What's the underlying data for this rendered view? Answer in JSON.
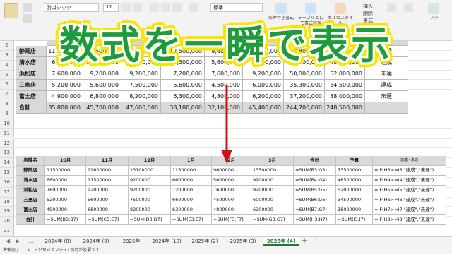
{
  "ribbon": {
    "font_name": "游ゴシック",
    "font_size": "11",
    "number_format": "標準",
    "conditional_format_label": "条件付き書式",
    "table_format_label": "テーブルとして書式設定",
    "cell_style_label": "セルのスタイル",
    "insert_label": "挿入",
    "delete_label": "削除",
    "format_label": "書式",
    "group_alignment": "配置",
    "addin_label": "アド"
  },
  "banner": {
    "text": "数式を一瞬で表示"
  },
  "row_numbers": [
    "2",
    "3",
    "4",
    "5",
    "6",
    "7",
    "8",
    "9",
    "10",
    "11",
    "12",
    "13",
    "14",
    "15",
    "16",
    "17",
    "18",
    "19",
    "20",
    "21"
  ],
  "top_table": {
    "headers": [
      "",
      "",
      "",
      "1月",
      "2月",
      "",
      "合計",
      "予算",
      ""
    ],
    "rows": [
      {
        "name": "静岡店",
        "values": [
          "11,500,000",
          "12,600,000",
          "13,100,000",
          "12,500,000",
          "9,600,000",
          "13,500,000",
          "72,800,000",
          "73,500,000",
          "未達"
        ]
      },
      {
        "name": "清水店",
        "values": [
          "6,600,000",
          "11,500,000",
          "9,200,000",
          "6,600,000",
          "5,600,000",
          "9,200,000",
          "48,600,000",
          "48,500,000",
          "達成"
        ]
      },
      {
        "name": "浜松店",
        "values": [
          "7,600,000",
          "9,200,000",
          "9,200,000",
          "7,200,000",
          "7,600,000",
          "9,200,000",
          "50,000,000",
          "52,000,000",
          "未達"
        ]
      },
      {
        "name": "三島店",
        "values": [
          "5,200,000",
          "5,600,000",
          "7,500,000",
          "6,600,000",
          "4,500,000",
          "6,000,000",
          "35,300,000",
          "34,500,000",
          "達成"
        ]
      },
      {
        "name": "富士店",
        "values": [
          "4,900,000",
          "6,800,000",
          "8,200,000",
          "6,300,000",
          "4,800,000",
          "6,200,000",
          "37,200,000",
          "38,000,000",
          "未達"
        ]
      },
      {
        "name": "合計",
        "values": [
          "35,800,000",
          "45,700,000",
          "47,600,000",
          "38,100,000",
          "32,100,000",
          "45,400,000",
          "244,700,000",
          "248,500,000",
          ""
        ]
      }
    ]
  },
  "bottom_table": {
    "headers": [
      "店舗名",
      "10月",
      "11月",
      "12月",
      "1月",
      "2月",
      "3月",
      "合計",
      "予算",
      "達成・未達"
    ],
    "rows": [
      {
        "name": "静岡店",
        "cells": [
          "11500000",
          "12600000",
          "13100000",
          "12500000",
          "9600000",
          "13500000",
          "=SUM(B3:G3)",
          "73500000",
          "=IF(H3>=I3,\"達成\",\"未達\")"
        ]
      },
      {
        "name": "清水店",
        "cells": [
          "6600000",
          "11500000",
          "9200000",
          "6600000",
          "5600000",
          "9200000",
          "=SUM(B4:G4)",
          "48500000",
          "=IF(H4>=I4,\"達成\",\"未達\")"
        ]
      },
      {
        "name": "浜松店",
        "cells": [
          "7600000",
          "9200000",
          "9200000",
          "7200000",
          "7600000",
          "9200000",
          "=SUM(B5:G5)",
          "52000000",
          "=IF(H5>=I5,\"達成\",\"未達\")"
        ]
      },
      {
        "name": "三島店",
        "cells": [
          "5200000",
          "5600000",
          "7500000",
          "6600000",
          "4500000",
          "6000000",
          "=SUM(B6:G6)",
          "34500000",
          "=IF(H6>=I6,\"達成\",\"未達\")"
        ]
      },
      {
        "name": "富士店",
        "cells": [
          "4900000",
          "6800000",
          "8200000",
          "6300000",
          "4800000",
          "6200000",
          "=SUM(B7:G7)",
          "38000000",
          "=IF(H7>=I7,\"達成\",\"未達\")"
        ]
      },
      {
        "name": "合計",
        "cells": [
          "=SUM(B3:B7)",
          "=SUM(C3:C7)",
          "=SUM(D3:D7)",
          "=SUM(E3:E7)",
          "=SUM(F3:F7)",
          "=SUM(G3:G7)",
          "=SUM(H3:H7)",
          "=SUM(I3:I7)",
          "=IF(H8>=I8,\"達成\",\"未達\")"
        ]
      }
    ]
  },
  "sheet_tabs": [
    "2024年 (8)",
    "2024年 (9)",
    "2025年",
    "2024年 (10)",
    "2025年 (2)",
    "2025年 (3)",
    "2025年 (4)"
  ],
  "active_tab_index": 6,
  "add_sheet": "+",
  "status": {
    "ready": "準備完了",
    "accessibility": "アクセシビリティ: 検討が必要です"
  },
  "colors": {
    "banner_text": "#1e9b3a",
    "banner_outline": "#f4e600",
    "arrow": "#c81414",
    "header_fill": "#d9d9d9"
  }
}
